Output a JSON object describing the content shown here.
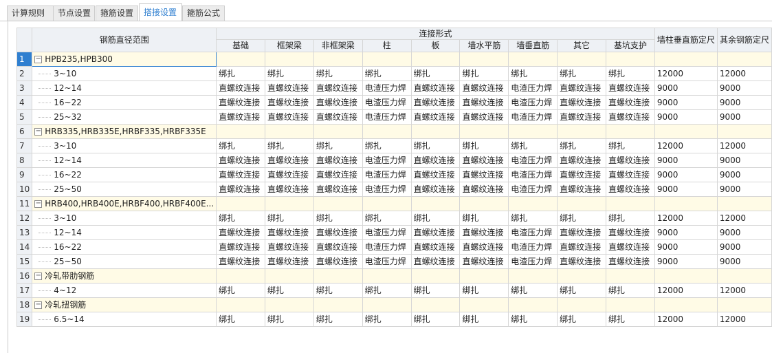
{
  "tabs": [
    {
      "label": "计算规则",
      "active": false
    },
    {
      "label": "节点设置",
      "active": false
    },
    {
      "label": "箍筋设置",
      "active": false
    },
    {
      "label": "搭接设置",
      "active": true
    },
    {
      "label": "箍筋公式",
      "active": false
    }
  ],
  "header": {
    "range_title": "钢筋直径范围",
    "connection_title": "连接形式",
    "columns": [
      "基础",
      "框架梁",
      "非框架梁",
      "柱",
      "板",
      "墙水平筋",
      "墙垂直筋",
      "其它",
      "基坑支护"
    ],
    "wall_length": "墙柱垂直筋定尺",
    "other_length": "其余钢筋定尺"
  },
  "rows": [
    {
      "n": "1",
      "group": true,
      "name": "HPB235,HPB300"
    },
    {
      "n": "2",
      "group": false,
      "name": "3~10",
      "c": [
        "绑扎",
        "绑扎",
        "绑扎",
        "绑扎",
        "绑扎",
        "绑扎",
        "绑扎",
        "绑扎",
        "绑扎"
      ],
      "w": "12000",
      "o": "12000"
    },
    {
      "n": "3",
      "group": false,
      "name": "12~14",
      "c": [
        "直螺纹连接",
        "直螺纹连接",
        "直螺纹连接",
        "电渣压力焊",
        "直螺纹连接",
        "直螺纹连接",
        "电渣压力焊",
        "直螺纹连接",
        "直螺纹连接"
      ],
      "w": "9000",
      "o": "9000"
    },
    {
      "n": "4",
      "group": false,
      "name": "16~22",
      "c": [
        "直螺纹连接",
        "直螺纹连接",
        "直螺纹连接",
        "电渣压力焊",
        "直螺纹连接",
        "直螺纹连接",
        "电渣压力焊",
        "直螺纹连接",
        "直螺纹连接"
      ],
      "w": "9000",
      "o": "9000"
    },
    {
      "n": "5",
      "group": false,
      "name": "25~32",
      "c": [
        "直螺纹连接",
        "直螺纹连接",
        "直螺纹连接",
        "电渣压力焊",
        "直螺纹连接",
        "直螺纹连接",
        "电渣压力焊",
        "直螺纹连接",
        "直螺纹连接"
      ],
      "w": "9000",
      "o": "9000"
    },
    {
      "n": "6",
      "group": true,
      "name": "HRB335,HRB335E,HRBF335,HRBF335E"
    },
    {
      "n": "7",
      "group": false,
      "name": "3~10",
      "c": [
        "绑扎",
        "绑扎",
        "绑扎",
        "绑扎",
        "绑扎",
        "绑扎",
        "绑扎",
        "绑扎",
        "绑扎"
      ],
      "w": "12000",
      "o": "12000"
    },
    {
      "n": "8",
      "group": false,
      "name": "12~14",
      "c": [
        "直螺纹连接",
        "直螺纹连接",
        "直螺纹连接",
        "电渣压力焊",
        "直螺纹连接",
        "直螺纹连接",
        "电渣压力焊",
        "直螺纹连接",
        "直螺纹连接"
      ],
      "w": "9000",
      "o": "9000"
    },
    {
      "n": "9",
      "group": false,
      "name": "16~22",
      "c": [
        "直螺纹连接",
        "直螺纹连接",
        "直螺纹连接",
        "电渣压力焊",
        "直螺纹连接",
        "直螺纹连接",
        "电渣压力焊",
        "直螺纹连接",
        "直螺纹连接"
      ],
      "w": "9000",
      "o": "9000"
    },
    {
      "n": "10",
      "group": false,
      "name": "25~50",
      "c": [
        "直螺纹连接",
        "直螺纹连接",
        "直螺纹连接",
        "电渣压力焊",
        "直螺纹连接",
        "直螺纹连接",
        "电渣压力焊",
        "直螺纹连接",
        "直螺纹连接"
      ],
      "w": "9000",
      "o": "9000"
    },
    {
      "n": "11",
      "group": true,
      "name": "HRB400,HRB400E,HRBF400,HRBF400E..."
    },
    {
      "n": "12",
      "group": false,
      "name": "3~10",
      "c": [
        "绑扎",
        "绑扎",
        "绑扎",
        "绑扎",
        "绑扎",
        "绑扎",
        "绑扎",
        "绑扎",
        "绑扎"
      ],
      "w": "12000",
      "o": "12000"
    },
    {
      "n": "13",
      "group": false,
      "name": "12~14",
      "c": [
        "直螺纹连接",
        "直螺纹连接",
        "直螺纹连接",
        "电渣压力焊",
        "直螺纹连接",
        "直螺纹连接",
        "电渣压力焊",
        "直螺纹连接",
        "直螺纹连接"
      ],
      "w": "9000",
      "o": "9000"
    },
    {
      "n": "14",
      "group": false,
      "name": "16~22",
      "c": [
        "直螺纹连接",
        "直螺纹连接",
        "直螺纹连接",
        "电渣压力焊",
        "直螺纹连接",
        "直螺纹连接",
        "电渣压力焊",
        "直螺纹连接",
        "直螺纹连接"
      ],
      "w": "9000",
      "o": "9000"
    },
    {
      "n": "15",
      "group": false,
      "name": "25~50",
      "c": [
        "直螺纹连接",
        "直螺纹连接",
        "直螺纹连接",
        "电渣压力焊",
        "直螺纹连接",
        "直螺纹连接",
        "电渣压力焊",
        "直螺纹连接",
        "直螺纹连接"
      ],
      "w": "9000",
      "o": "9000"
    },
    {
      "n": "16",
      "group": true,
      "name": "冷轧带肋钢筋"
    },
    {
      "n": "17",
      "group": false,
      "name": "4~12",
      "c": [
        "绑扎",
        "绑扎",
        "绑扎",
        "绑扎",
        "绑扎",
        "绑扎",
        "绑扎",
        "绑扎",
        "绑扎"
      ],
      "w": "12000",
      "o": "12000"
    },
    {
      "n": "18",
      "group": true,
      "name": "冷轧扭钢筋"
    },
    {
      "n": "19",
      "group": false,
      "name": "6.5~14",
      "c": [
        "绑扎",
        "绑扎",
        "绑扎",
        "绑扎",
        "绑扎",
        "绑扎",
        "绑扎",
        "绑扎",
        "绑扎"
      ],
      "w": "12000",
      "o": "12000"
    }
  ],
  "icons": {
    "collapse": "minus-box-icon"
  }
}
